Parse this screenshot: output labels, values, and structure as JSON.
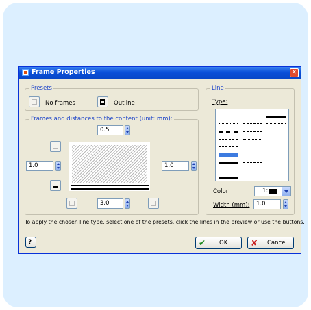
{
  "window": {
    "title": "Frame Properties",
    "close_glyph": "✕"
  },
  "presets": {
    "legend": "Presets",
    "no_frames_label": "No frames",
    "outline_label": "Outline"
  },
  "distances": {
    "legend": "Frames and distances to the content (unit: mm):",
    "top_value": "0.5",
    "left_value": "1.0",
    "right_value": "1.0",
    "bottom_value": "3.0"
  },
  "line": {
    "legend": "Line",
    "type_label": "Type:",
    "color_label": "Color:",
    "color_value": "1:",
    "color_hex": "#000000",
    "width_label": "Width (mm):",
    "width_value": "1.0"
  },
  "hint_text": "To apply the chosen line type, select one of the presets, click the lines in the preview or use the buttons.",
  "buttons": {
    "ok_label": "OK",
    "cancel_label": "Cancel",
    "help_glyph": "?"
  },
  "colors": {
    "dialog_bg": "#ece9d8",
    "titlebar": "#0a4fd8",
    "group_label": "#2248c9",
    "panel_bg": "#dcefff",
    "ok_icon": "#1e8a1e",
    "cancel_icon": "#c81e1e"
  },
  "icons": [
    "app-icon",
    "close-icon",
    "help-icon",
    "check-icon",
    "cross-icon"
  ]
}
